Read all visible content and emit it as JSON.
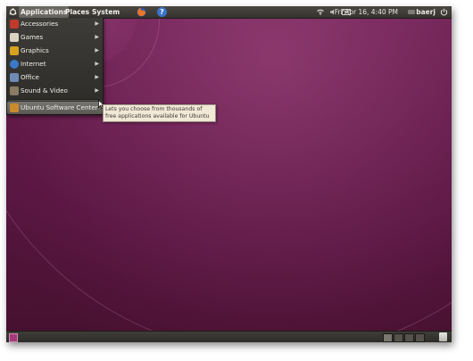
{
  "top_panel": {
    "menus": {
      "applications": "Applications",
      "places": "Places",
      "system": "System"
    },
    "launchers": [
      "firefox-icon",
      "help-icon"
    ],
    "help_glyph": "?",
    "tray": {
      "clock": "Fri Apr 16,  4:40 PM",
      "user": "baerj"
    }
  },
  "applications_menu": {
    "items": [
      {
        "label": "Accessories",
        "icon": "accessories-icon",
        "color": "#c0392b"
      },
      {
        "label": "Games",
        "icon": "games-icon",
        "color": "#d9d2c2"
      },
      {
        "label": "Graphics",
        "icon": "graphics-icon",
        "color": "#d8a21e"
      },
      {
        "label": "Internet",
        "icon": "internet-icon",
        "color": "#3a78c9"
      },
      {
        "label": "Office",
        "icon": "office-icon",
        "color": "#6d8bb5"
      },
      {
        "label": "Sound & Video",
        "icon": "sound-video-icon",
        "color": "#8a7a64"
      },
      {
        "label": "Ubuntu Software Center",
        "icon": "software-center-icon",
        "color": "#c98b2e"
      }
    ],
    "highlighted_index": 6
  },
  "tooltip": {
    "line1": "Lets you choose from thousands of",
    "line2": "free applications available for Ubuntu"
  },
  "colors": {
    "desktop_base": "#5b1842",
    "panel": "#3c3a35",
    "accent": "#a43a7a"
  }
}
